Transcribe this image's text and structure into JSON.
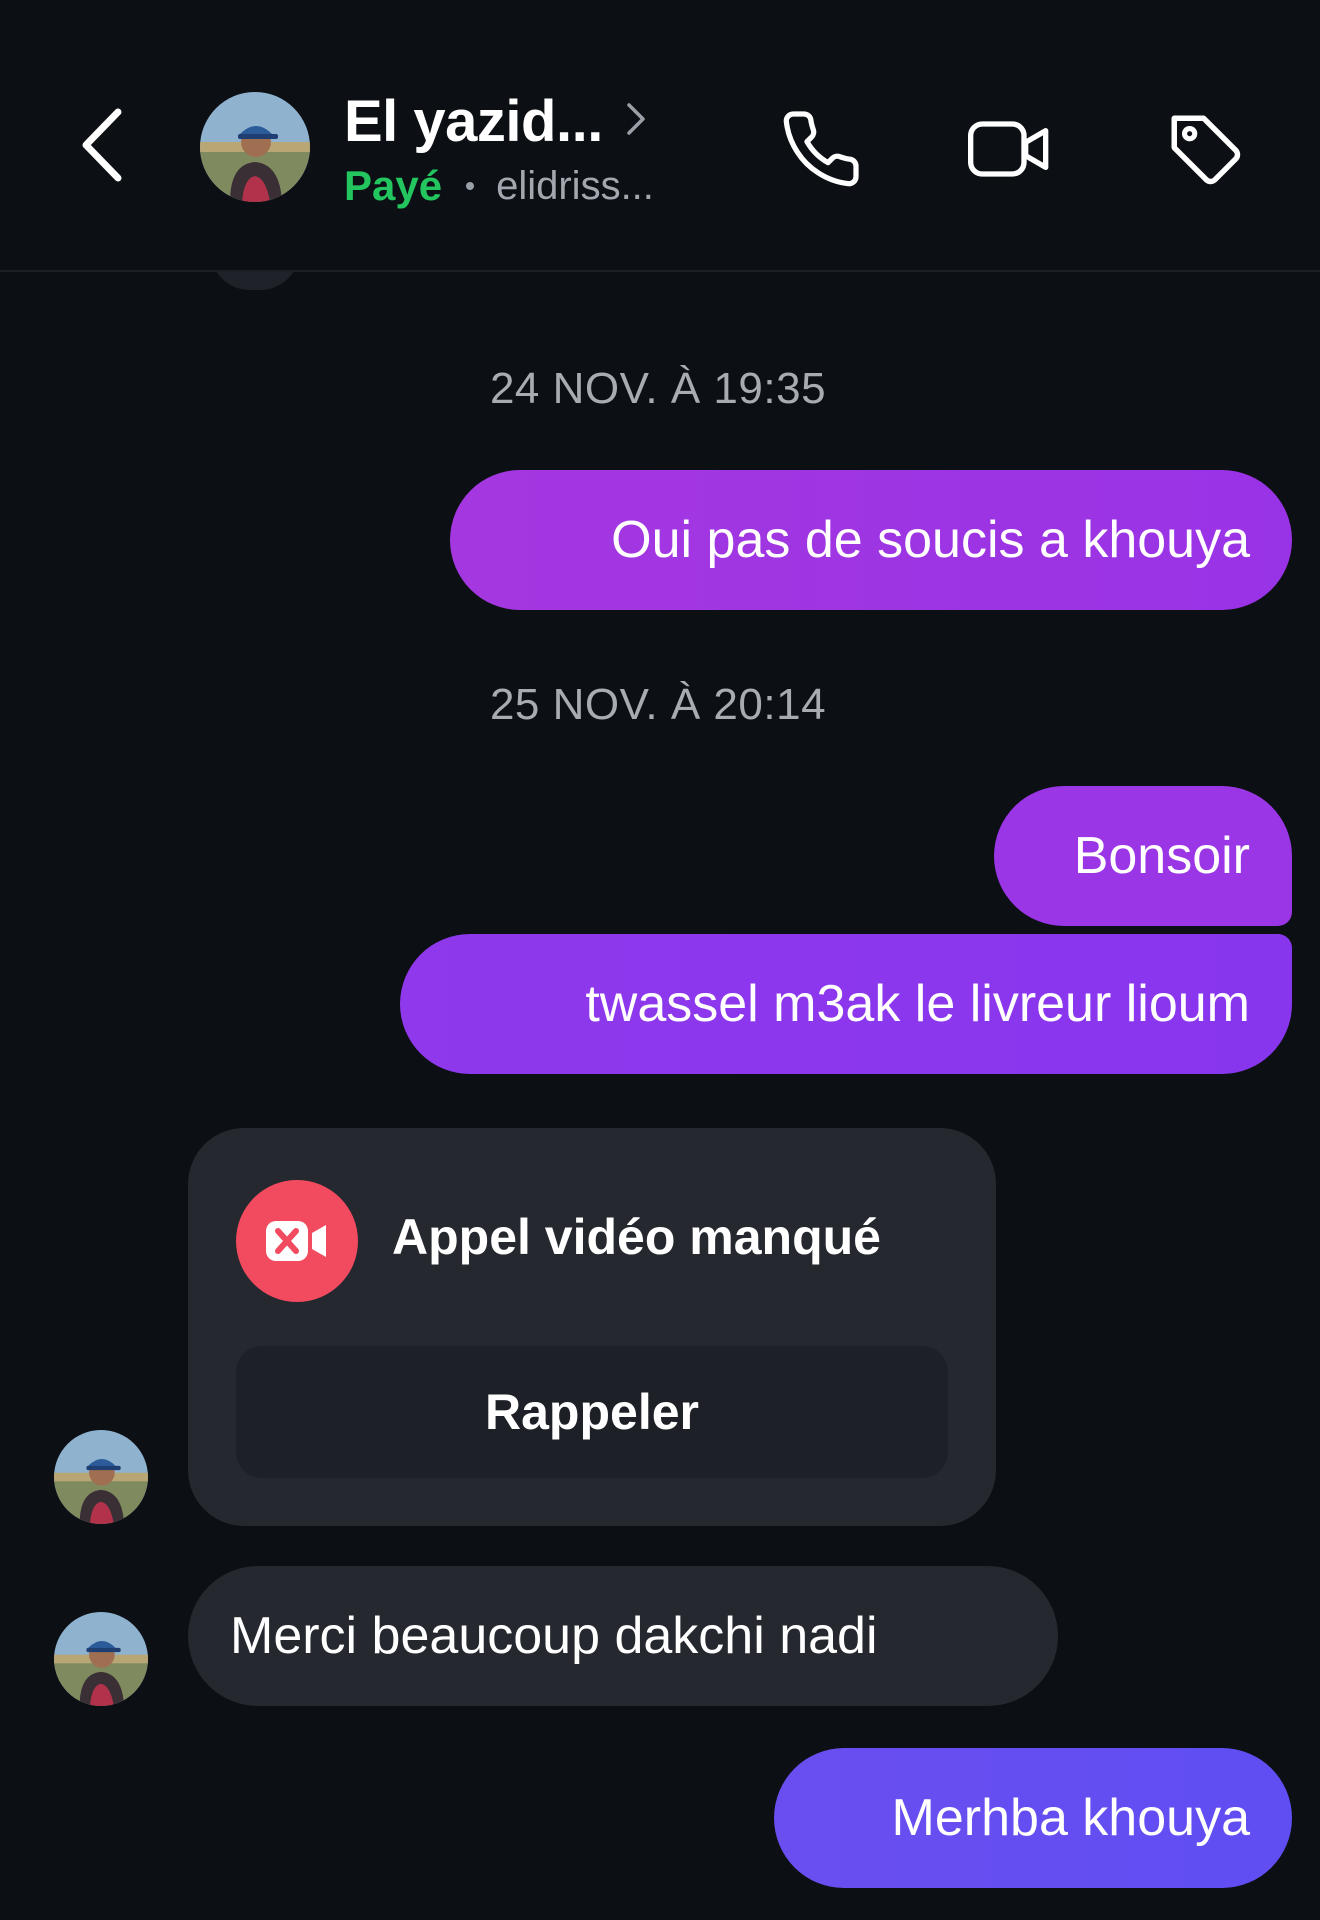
{
  "header": {
    "back_icon": "chevron-left-icon",
    "contact_name": "El yazid...",
    "status": "Payé",
    "handle": "elidriss...",
    "status_color": "#22c55e",
    "actions": [
      {
        "name": "phone-icon"
      },
      {
        "name": "video-camera-icon"
      },
      {
        "name": "tag-icon"
      }
    ]
  },
  "messages": {
    "timestamp_1": "24 NOV. À 19:35",
    "out_1": "Oui pas de soucis a khouya",
    "timestamp_2": "25 NOV. À 20:14",
    "out_2": "Bonsoir",
    "out_3": "twassel m3ak le livreur lioum",
    "missed_call": {
      "title": "Appel vidéo manqué",
      "button": "Rappeler",
      "icon": "missed-video-call-icon",
      "icon_color": "#f24b5f"
    },
    "in_1": "Merci beaucoup dakchi nadi",
    "out_4": "Merhba khouya"
  },
  "colors": {
    "background": "#0c0f14",
    "outgoing_purple": "#9a36e6",
    "outgoing_indigo": "#6a4ef0",
    "incoming_gray": "#25282e"
  }
}
